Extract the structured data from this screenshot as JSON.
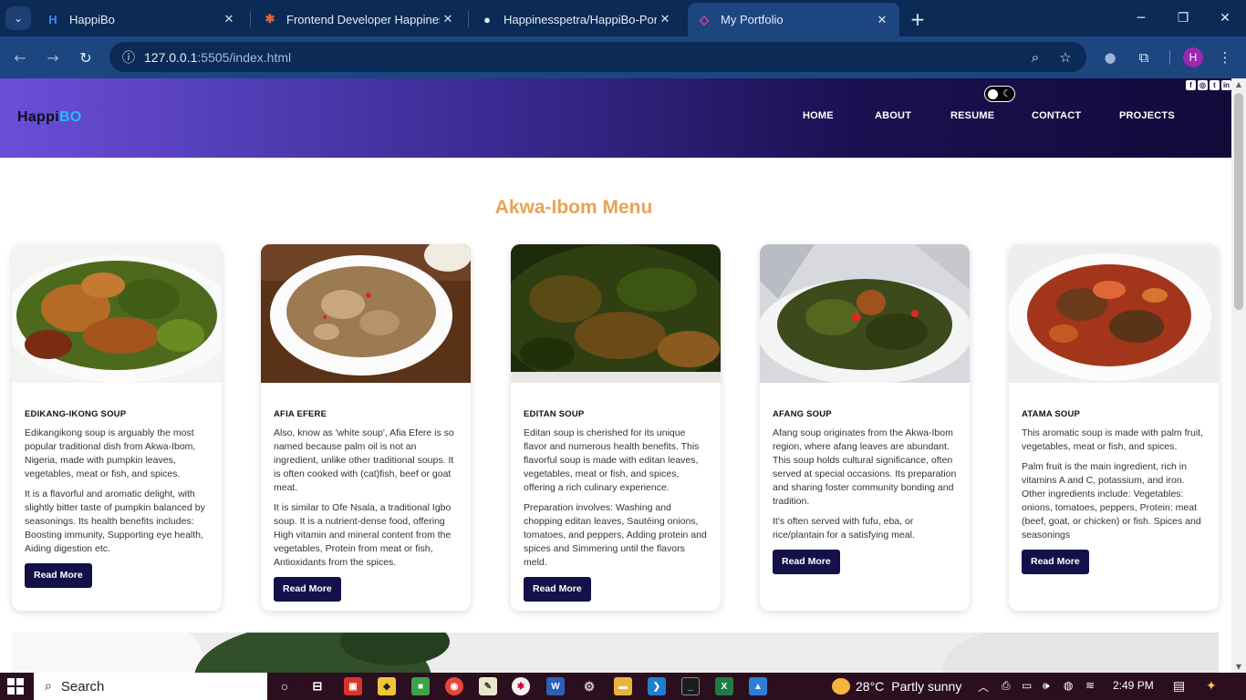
{
  "browser": {
    "tabs": [
      {
        "label": "HappiBo",
        "icon": "H"
      },
      {
        "label": "Frontend Developer Happiness",
        "icon": "✱"
      },
      {
        "label": "Happinesspetra/HappiBo-Portfo",
        "icon": "●"
      },
      {
        "label": "My Portfolio",
        "icon": "◇"
      }
    ],
    "url_host": "127.0.0.1",
    "url_rest": ":5505/index.html",
    "profile_initial": "H"
  },
  "site": {
    "logo_main": "Happi",
    "logo_accent": "BO",
    "nav": [
      "HOME",
      "ABOUT",
      "RESUME",
      "CONTACT",
      "PROJECTS"
    ],
    "social": [
      "f",
      "◎",
      "t",
      "in"
    ],
    "section_title": "Akwa-Ibom Menu",
    "read_more": "Read More",
    "cards": [
      {
        "title": "EDIKANG-IKONG SOUP",
        "p1": "Edikangikong soup is arguably the most popular traditional dish from Akwa-Ibom, Nigeria, made with pumpkin leaves, vegetables, meat or fish, and spices.",
        "p2": "It is a flavorful and aromatic delight, with slightly bitter taste of pumpkin balanced by seasonings. Its health benefits includes: Boosting immunity, Supporting eye health, Aiding digestion etc."
      },
      {
        "title": "AFIA EFERE",
        "p1": "Also, know as 'white soup', Afia Efere is so named because palm oil is not an ingredient, unlike other traditional soups. It is often cooked with (cat)fish, beef or goat meat.",
        "p2": "It is similar to Ofe Nsala, a traditional Igbo soup. It is a nutrient-dense food, offering High vitamin and mineral content from the vegetables, Protein from meat or fish, Antioxidants from the spices."
      },
      {
        "title": "EDITAN SOUP",
        "p1": "Editan soup is cherished for its unique flavor and numerous health benefits. This flavorful soup is made with editan leaves, vegetables, meat or fish, and spices, offering a rich culinary experience.",
        "p2": "Preparation involves: Washing and chopping editan leaves, Sautéing onions, tomatoes, and peppers, Adding protein and spices and Simmering until the flavors meld."
      },
      {
        "title": "AFANG SOUP",
        "p1": "Afang soup originates from the Akwa-Ibom region, where afang leaves are abundant. This soup holds cultural significance, often served at special occasions. Its preparation and sharing foster community bonding and tradition.",
        "p2": "It's often served with fufu, eba, or rice/plantain for a satisfying meal."
      },
      {
        "title": "ATAMA SOUP",
        "p1": "This aromatic soup is made with palm fruit, vegetables, meat or fish, and spices.",
        "p2": "Palm fruit is the main ingredient, rich in vitamins A and C, potassium, and iron. Other ingredients include: Vegetables: onions, tomatoes, peppers, Protein: meat (beef, goat, or chicken) or fish. Spices and seasonings"
      }
    ]
  },
  "taskbar": {
    "search": "Search",
    "temperature": "28°C",
    "weather": "Partly sunny",
    "time": "2:49 PM"
  }
}
